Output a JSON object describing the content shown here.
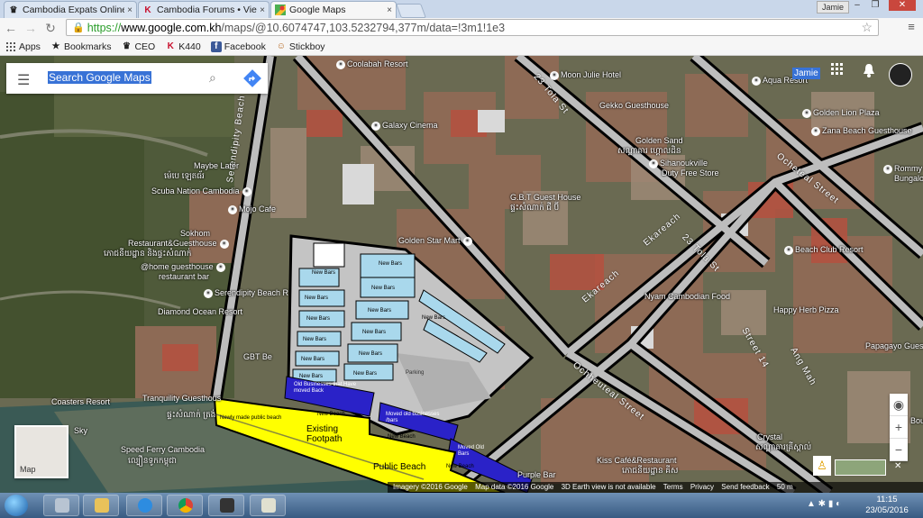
{
  "browser": {
    "tabs": [
      {
        "title": "Cambodia Expats Online",
        "icon": "crown-icon",
        "active": false
      },
      {
        "title": "Cambodia Forums • View",
        "icon": "k-logo-icon",
        "active": false
      },
      {
        "title": "Google Maps",
        "icon": "google-maps-icon",
        "active": true
      }
    ],
    "profile": "Jamie",
    "url_https": "https://",
    "url_host": "www.google.com.kh",
    "url_path": "/maps/@10.6074747,103.5232794,377m/data=!3m1!1e3",
    "bookmarks": [
      {
        "label": "Apps",
        "icon": "apps-grid-icon"
      },
      {
        "label": "Bookmarks",
        "icon": "star-icon"
      },
      {
        "label": "CEO",
        "icon": "crown-icon"
      },
      {
        "label": "K440",
        "icon": "k-logo-icon"
      },
      {
        "label": "Facebook",
        "icon": "facebook-icon"
      },
      {
        "label": "Stickboy",
        "icon": "stickboy-icon"
      }
    ]
  },
  "maps": {
    "search_placeholder": "Search Google Maps",
    "account_name": "Jamie",
    "minimap_label": "Map",
    "zoom_in": "+",
    "zoom_out": "−",
    "attribution": [
      "Imagery ©2016 Google",
      "Map data ©2016 Google",
      "3D Earth view is not available",
      "Terms",
      "Privacy",
      "Send feedback",
      "50 m"
    ],
    "places": {
      "coolabah": "Coolabah Resort",
      "moon_julie": "Moon Julie Hotel",
      "gekko": "Gekko Guesthouse",
      "galaxy": "Galaxy Cinema",
      "golden_sand": "Golden Sand",
      "golden_sand_km": "សណ្ឋាគារ ហ្គោលដិន",
      "sihanoukville": "Sihanoukville",
      "duty_free": "Duty Free Store",
      "aqua": "Aqua Resort",
      "golden_lion": "Golden Lion Plaza",
      "zana": "Zana Beach Guesthouse",
      "rommy": "Rommy",
      "bungalo": "Bungalo",
      "maybe_later": "Maybe Later",
      "maybe_later_km": "ម៉េបេ ឡេតធ័រ",
      "scuba": "Scuba Nation Cambodia",
      "mojo": "Mojo Cafe",
      "gbt_guest": "G.B.T Guest House",
      "gbt_guest_km": "ផ្ទះសំណាក់ ជី ប៊ី",
      "golden_star": "Golden Star Mart",
      "sokhom": "Sokhom",
      "sokhom2": "Restaurant&Guesthouse",
      "sokhom_km": "ភោជនីយដ្ឋាន និងផ្ទះសំណាក់",
      "home_gh": "@home guesthouse",
      "home_gh2": "restaurant bar",
      "serendipity": "Serendipity Beach R",
      "diamond": "Diamond Ocean Resort",
      "gbt_beach": "GBT Be",
      "beach_club": "Beach Club Resort",
      "nyam": "Nyam Cambodian Food",
      "happy_herb": "Happy Herb Pizza",
      "papagayo": "Papagayo Guest",
      "coasters": "Coasters Resort",
      "tranquility": "Tranquility Guesthous",
      "tranquility_km": "ផ្ទះសំណាក់ ត្រង់",
      "sky": "Sky",
      "speed_ferry": "Speed Ferry Cambodia",
      "speed_ferry_km": "ល្បឿនទូកកម្ពុជា",
      "crystal": "Crystal",
      "crystal_km": "សណ្ឋាគារគ្រីស្តាល់",
      "kiss": "Kiss Café&Restaurant",
      "kiss_km": "ភោជនីយដ្ឋាន គីស",
      "purple": "Purple Bar",
      "bou": "Bou"
    },
    "roads": {
      "serendipity_beach_rd": "Serendipity Beach Rd",
      "st_23": "23 Tola St",
      "st_23b": "23 Tola St",
      "ekareach": "Ekareach",
      "ekareach2": "Ekareach",
      "ocheteal": "Ocheteal Street",
      "ochheuteal": "Ochheuteal Street",
      "street_14": "Street 14",
      "ang_mah": "Ang Mah"
    },
    "overlay": {
      "new_bars": "New Bars",
      "old_businesses": "Old Businesses that Have moved Back",
      "new_beach_1": "New Beach",
      "moved_old_1": "Moved old businesses /bars",
      "new_beach_2": "New Beach",
      "moved_old_2": "Moved Old Bars",
      "new_beach_3": "New Beach",
      "newly_made": "Newly made public beach",
      "existing_footpath": "Existing Footpath",
      "public_beach": "Public Beach",
      "parking": "Parking"
    }
  },
  "taskbar": {
    "time": "11:15",
    "date": "23/05/2016"
  },
  "colors": {
    "overlay_yellow": "#ffff00",
    "overlay_blue": "#2a22c8",
    "overlay_light_blue": "#a9d8ec",
    "overlay_gray": "#b9b9b9",
    "overlay_road_gray": "#c4c4c4",
    "accent_blue": "#3872d6"
  }
}
